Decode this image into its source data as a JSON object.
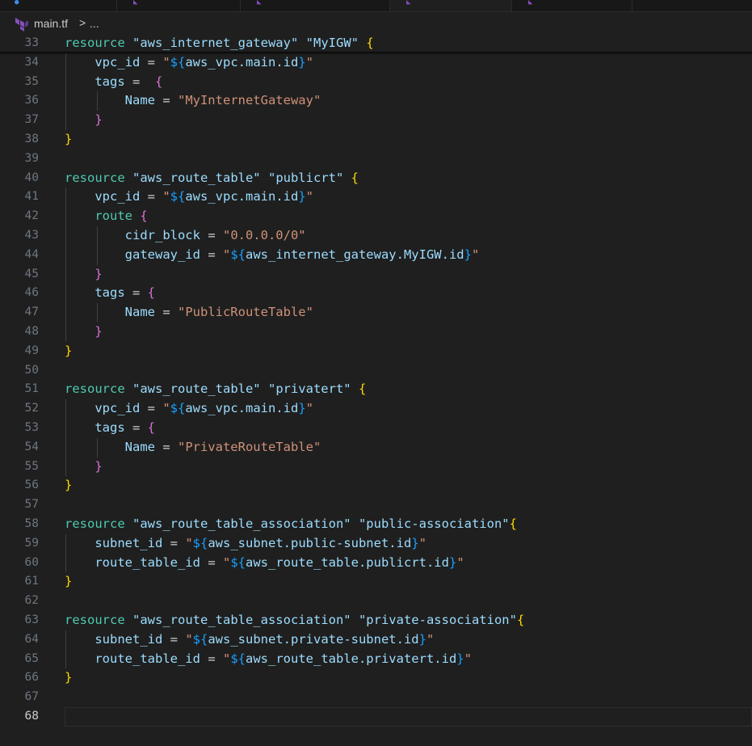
{
  "breadcrumb": {
    "file": "main.tf",
    "separator": ">",
    "ellipsis": "..."
  },
  "colors": {
    "background": "#1f1f1f",
    "keyword": "#4ec9b0",
    "string": "#ce9178",
    "identifier": "#9cdcfe",
    "bracket_level1": "#ffd700",
    "bracket_level2": "#da70d6",
    "bracket_level3": "#179fff",
    "line_number": "#6e7681",
    "terraform_icon": "#844fba"
  },
  "icons": [
    "terraform-icon",
    "chevron-right-icon"
  ],
  "editor": {
    "sticky_line": {
      "number": "33",
      "tokens": [
        {
          "t": "resource",
          "c": "k"
        },
        {
          "t": " ",
          "c": "p"
        },
        {
          "t": "\"aws_internet_gateway\"",
          "c": "v"
        },
        {
          "t": " ",
          "c": "p"
        },
        {
          "t": "\"MyIGW\"",
          "c": "v"
        },
        {
          "t": " ",
          "c": "p"
        },
        {
          "t": "{",
          "c": "b1"
        }
      ]
    },
    "current_line": "68",
    "lines": [
      {
        "n": "34",
        "tokens": [
          {
            "t": "    vpc_id",
            "c": "i"
          },
          {
            "t": " = ",
            "c": "p"
          },
          {
            "t": "\"",
            "c": "s"
          },
          {
            "t": "${",
            "c": "b3"
          },
          {
            "t": "aws_vpc.main.id",
            "c": "i"
          },
          {
            "t": "}",
            "c": "b3"
          },
          {
            "t": "\"",
            "c": "s"
          }
        ]
      },
      {
        "n": "35",
        "tokens": [
          {
            "t": "    tags",
            "c": "i"
          },
          {
            "t": " =  ",
            "c": "p"
          },
          {
            "t": "{",
            "c": "b2"
          }
        ]
      },
      {
        "n": "36",
        "tokens": [
          {
            "t": "        Name",
            "c": "i"
          },
          {
            "t": " = ",
            "c": "p"
          },
          {
            "t": "\"MyInternetGateway\"",
            "c": "s"
          }
        ]
      },
      {
        "n": "37",
        "tokens": [
          {
            "t": "    ",
            "c": "p"
          },
          {
            "t": "}",
            "c": "b2"
          }
        ]
      },
      {
        "n": "38",
        "tokens": [
          {
            "t": "}",
            "c": "b1"
          }
        ]
      },
      {
        "n": "39",
        "tokens": []
      },
      {
        "n": "40",
        "tokens": [
          {
            "t": "resource",
            "c": "k"
          },
          {
            "t": " ",
            "c": "p"
          },
          {
            "t": "\"aws_route_table\"",
            "c": "v"
          },
          {
            "t": " ",
            "c": "p"
          },
          {
            "t": "\"publicrt\"",
            "c": "v"
          },
          {
            "t": " ",
            "c": "p"
          },
          {
            "t": "{",
            "c": "b1"
          }
        ]
      },
      {
        "n": "41",
        "tokens": [
          {
            "t": "    vpc_id",
            "c": "i"
          },
          {
            "t": " = ",
            "c": "p"
          },
          {
            "t": "\"",
            "c": "s"
          },
          {
            "t": "${",
            "c": "b3"
          },
          {
            "t": "aws_vpc.main.id",
            "c": "i"
          },
          {
            "t": "}",
            "c": "b3"
          },
          {
            "t": "\"",
            "c": "s"
          }
        ]
      },
      {
        "n": "42",
        "tokens": [
          {
            "t": "    route",
            "c": "k"
          },
          {
            "t": " ",
            "c": "p"
          },
          {
            "t": "{",
            "c": "b2"
          }
        ]
      },
      {
        "n": "43",
        "tokens": [
          {
            "t": "        cidr_block",
            "c": "i"
          },
          {
            "t": " = ",
            "c": "p"
          },
          {
            "t": "\"0.0.0.0/0\"",
            "c": "s"
          }
        ]
      },
      {
        "n": "44",
        "tokens": [
          {
            "t": "        gateway_id",
            "c": "i"
          },
          {
            "t": " = ",
            "c": "p"
          },
          {
            "t": "\"",
            "c": "s"
          },
          {
            "t": "${",
            "c": "b3"
          },
          {
            "t": "aws_internet_gateway.MyIGW.id",
            "c": "i"
          },
          {
            "t": "}",
            "c": "b3"
          },
          {
            "t": "\"",
            "c": "s"
          }
        ]
      },
      {
        "n": "45",
        "tokens": [
          {
            "t": "    ",
            "c": "p"
          },
          {
            "t": "}",
            "c": "b2"
          }
        ]
      },
      {
        "n": "46",
        "tokens": [
          {
            "t": "    tags",
            "c": "i"
          },
          {
            "t": " = ",
            "c": "p"
          },
          {
            "t": "{",
            "c": "b2"
          }
        ]
      },
      {
        "n": "47",
        "tokens": [
          {
            "t": "        Name",
            "c": "i"
          },
          {
            "t": " = ",
            "c": "p"
          },
          {
            "t": "\"PublicRouteTable\"",
            "c": "s"
          }
        ]
      },
      {
        "n": "48",
        "tokens": [
          {
            "t": "    ",
            "c": "p"
          },
          {
            "t": "}",
            "c": "b2"
          }
        ]
      },
      {
        "n": "49",
        "tokens": [
          {
            "t": "}",
            "c": "b1"
          }
        ]
      },
      {
        "n": "50",
        "tokens": []
      },
      {
        "n": "51",
        "tokens": [
          {
            "t": "resource",
            "c": "k"
          },
          {
            "t": " ",
            "c": "p"
          },
          {
            "t": "\"aws_route_table\"",
            "c": "v"
          },
          {
            "t": " ",
            "c": "p"
          },
          {
            "t": "\"privatert\"",
            "c": "v"
          },
          {
            "t": " ",
            "c": "p"
          },
          {
            "t": "{",
            "c": "b1"
          }
        ]
      },
      {
        "n": "52",
        "tokens": [
          {
            "t": "    vpc_id",
            "c": "i"
          },
          {
            "t": " = ",
            "c": "p"
          },
          {
            "t": "\"",
            "c": "s"
          },
          {
            "t": "${",
            "c": "b3"
          },
          {
            "t": "aws_vpc.main.id",
            "c": "i"
          },
          {
            "t": "}",
            "c": "b3"
          },
          {
            "t": "\"",
            "c": "s"
          }
        ]
      },
      {
        "n": "53",
        "tokens": [
          {
            "t": "    tags",
            "c": "i"
          },
          {
            "t": " = ",
            "c": "p"
          },
          {
            "t": "{",
            "c": "b2"
          }
        ]
      },
      {
        "n": "54",
        "tokens": [
          {
            "t": "        Name",
            "c": "i"
          },
          {
            "t": " = ",
            "c": "p"
          },
          {
            "t": "\"PrivateRouteTable\"",
            "c": "s"
          }
        ]
      },
      {
        "n": "55",
        "tokens": [
          {
            "t": "    ",
            "c": "p"
          },
          {
            "t": "}",
            "c": "b2"
          }
        ]
      },
      {
        "n": "56",
        "tokens": [
          {
            "t": "}",
            "c": "b1"
          }
        ]
      },
      {
        "n": "57",
        "tokens": []
      },
      {
        "n": "58",
        "tokens": [
          {
            "t": "resource",
            "c": "k"
          },
          {
            "t": " ",
            "c": "p"
          },
          {
            "t": "\"aws_route_table_association\"",
            "c": "v"
          },
          {
            "t": " ",
            "c": "p"
          },
          {
            "t": "\"public-association\"",
            "c": "v"
          },
          {
            "t": "{",
            "c": "b1"
          }
        ]
      },
      {
        "n": "59",
        "tokens": [
          {
            "t": "    subnet_id",
            "c": "i"
          },
          {
            "t": " = ",
            "c": "p"
          },
          {
            "t": "\"",
            "c": "s"
          },
          {
            "t": "${",
            "c": "b3"
          },
          {
            "t": "aws_subnet.public-subnet.id",
            "c": "i"
          },
          {
            "t": "}",
            "c": "b3"
          },
          {
            "t": "\"",
            "c": "s"
          }
        ]
      },
      {
        "n": "60",
        "tokens": [
          {
            "t": "    route_table_id",
            "c": "i"
          },
          {
            "t": " = ",
            "c": "p"
          },
          {
            "t": "\"",
            "c": "s"
          },
          {
            "t": "${",
            "c": "b3"
          },
          {
            "t": "aws_route_table.publicrt.id",
            "c": "i"
          },
          {
            "t": "}",
            "c": "b3"
          },
          {
            "t": "\"",
            "c": "s"
          }
        ]
      },
      {
        "n": "61",
        "tokens": [
          {
            "t": "}",
            "c": "b1"
          }
        ]
      },
      {
        "n": "62",
        "tokens": []
      },
      {
        "n": "63",
        "tokens": [
          {
            "t": "resource",
            "c": "k"
          },
          {
            "t": " ",
            "c": "p"
          },
          {
            "t": "\"aws_route_table_association\"",
            "c": "v"
          },
          {
            "t": " ",
            "c": "p"
          },
          {
            "t": "\"private-association\"",
            "c": "v"
          },
          {
            "t": "{",
            "c": "b1"
          }
        ]
      },
      {
        "n": "64",
        "tokens": [
          {
            "t": "    subnet_id",
            "c": "i"
          },
          {
            "t": " = ",
            "c": "p"
          },
          {
            "t": "\"",
            "c": "s"
          },
          {
            "t": "${",
            "c": "b3"
          },
          {
            "t": "aws_subnet.private-subnet.id",
            "c": "i"
          },
          {
            "t": "}",
            "c": "b3"
          },
          {
            "t": "\"",
            "c": "s"
          }
        ]
      },
      {
        "n": "65",
        "tokens": [
          {
            "t": "    route_table_id",
            "c": "i"
          },
          {
            "t": " = ",
            "c": "p"
          },
          {
            "t": "\"",
            "c": "s"
          },
          {
            "t": "${",
            "c": "b3"
          },
          {
            "t": "aws_route_table.privatert.id",
            "c": "i"
          },
          {
            "t": "}",
            "c": "b3"
          },
          {
            "t": "\"",
            "c": "s"
          }
        ]
      },
      {
        "n": "66",
        "tokens": [
          {
            "t": "}",
            "c": "b1"
          }
        ]
      },
      {
        "n": "67",
        "tokens": []
      },
      {
        "n": "68",
        "tokens": []
      }
    ]
  }
}
